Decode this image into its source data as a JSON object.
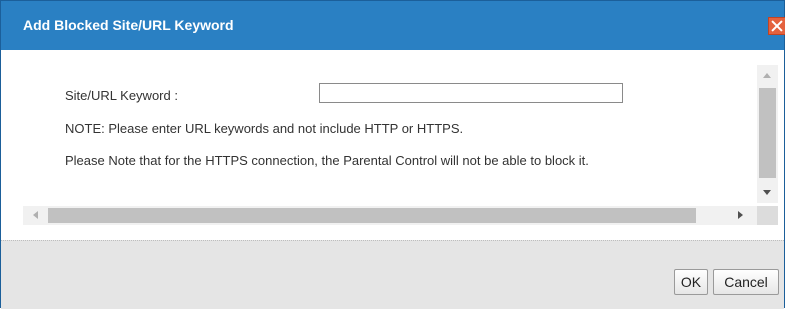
{
  "dialog": {
    "title": "Add Blocked Site/URL Keyword"
  },
  "form": {
    "keyword_label": "Site/URL Keyword :",
    "keyword_value": "",
    "note_1": "NOTE: Please enter URL keywords and not include HTTP or HTTPS.",
    "note_2": "Please Note that for the HTTPS connection, the Parental Control will not be able to block it."
  },
  "buttons": {
    "ok_label": "OK",
    "cancel_label": "Cancel"
  },
  "icons": {
    "close": "close-icon",
    "scroll_up": "arrow-up-icon",
    "scroll_down": "arrow-down-icon",
    "scroll_left": "arrow-left-icon",
    "scroll_right": "arrow-right-icon"
  },
  "colors": {
    "titlebar": "#2a80c3",
    "close_button": "#e4623e",
    "footer": "#e5e5e5"
  }
}
